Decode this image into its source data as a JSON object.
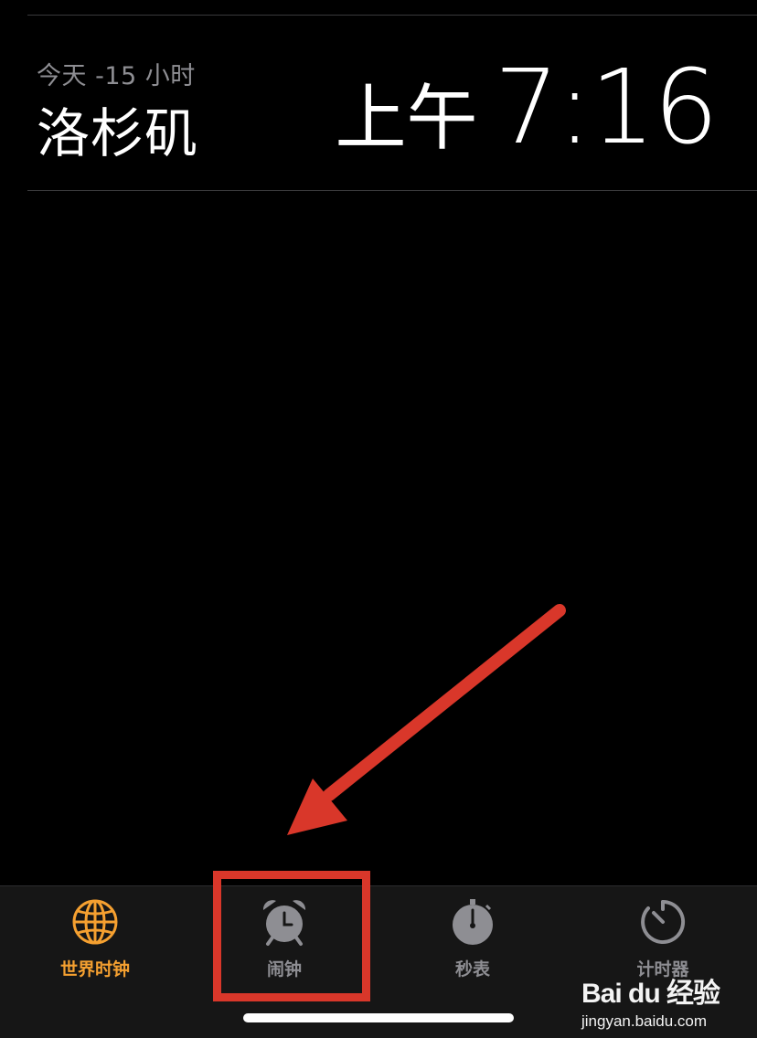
{
  "world_clock": {
    "entry": {
      "offset": "今天 -15 小时",
      "city": "洛杉矶",
      "ampm": "上午",
      "time": "7:16"
    }
  },
  "tabbar": {
    "tabs": [
      {
        "label": "世界时钟",
        "icon": "globe-icon",
        "active": true
      },
      {
        "label": "闹钟",
        "icon": "alarm-clock-icon",
        "active": false
      },
      {
        "label": "秒表",
        "icon": "stopwatch-icon",
        "active": false
      },
      {
        "label": "计时器",
        "icon": "timer-icon",
        "active": false
      }
    ]
  },
  "colors": {
    "accent": "#f5a030",
    "inactive": "#8e8e93",
    "annotation": "#d9372a",
    "background": "#000000"
  },
  "watermark": {
    "logo": "Bai du 经验",
    "url": "jingyan.baidu.com"
  }
}
